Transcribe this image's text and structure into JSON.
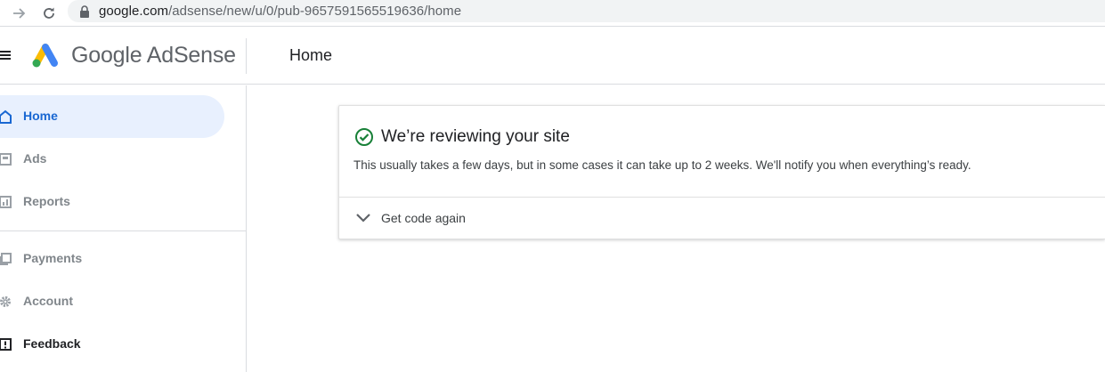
{
  "browser": {
    "url_host": "google.com",
    "url_path": "/adsense/new/u/0/pub-9657591565519636/home"
  },
  "header": {
    "brand": "Google AdSense",
    "title": "Home"
  },
  "sidebar": {
    "items": [
      {
        "label": "Home",
        "icon": "home-icon",
        "state": "active"
      },
      {
        "label": "Ads",
        "icon": "ads-icon",
        "state": "muted"
      },
      {
        "label": "Reports",
        "icon": "reports-icon",
        "state": "muted"
      },
      {
        "label": "Payments",
        "icon": "payments-icon",
        "state": "muted"
      },
      {
        "label": "Account",
        "icon": "gear-icon",
        "state": "muted"
      },
      {
        "label": "Feedback",
        "icon": "feedback-icon",
        "state": "normal"
      }
    ]
  },
  "card": {
    "title": "We’re reviewing your site",
    "description": "This usually takes a few days, but in some cases it can take up to 2 weeks. We'll notify you when everything’s ready.",
    "expand_label": "Get code again",
    "status_icon": "check-circle-icon"
  },
  "colors": {
    "accent": "#1967d2",
    "active_bg": "#e8f0fe",
    "success": "#188038",
    "muted": "#80868b"
  }
}
